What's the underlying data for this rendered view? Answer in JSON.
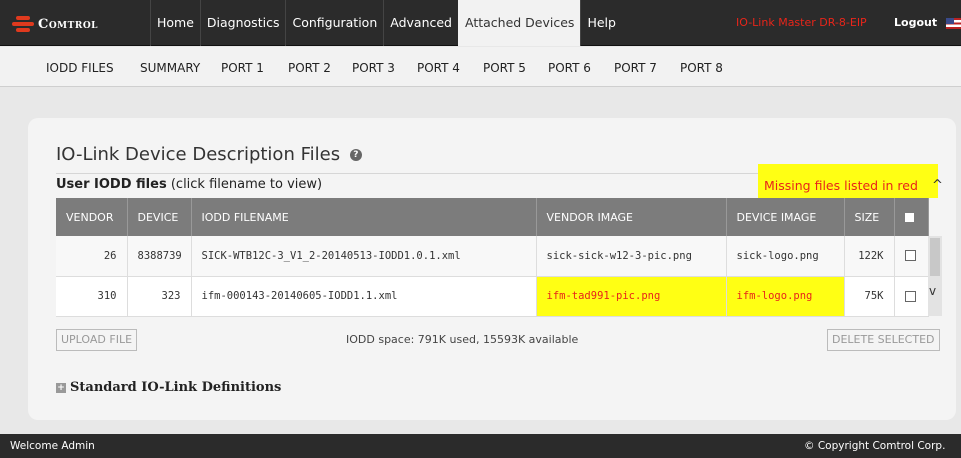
{
  "brand": {
    "logo_text": "Comtrol"
  },
  "nav": {
    "items": [
      "Home",
      "Diagnostics",
      "Configuration",
      "Advanced",
      "Attached Devices",
      "Help"
    ],
    "active": "Attached Devices",
    "device_name": "IO-Link Master DR-8-EIP",
    "logout": "Logout"
  },
  "subnav": {
    "items": [
      "IODD FILES",
      "SUMMARY",
      "PORT 1",
      "PORT 2",
      "PORT 3",
      "PORT 4",
      "PORT 5",
      "PORT 6",
      "PORT 7",
      "PORT 8"
    ]
  },
  "page": {
    "title": "IO-Link Device Description Files",
    "user_iodd_label": "User IODD files",
    "user_iodd_hint": "(click filename to view)",
    "missing_note": "Missing files listed in red"
  },
  "table": {
    "columns": [
      "VENDOR",
      "DEVICE",
      "IODD FILENAME",
      "VENDOR IMAGE",
      "DEVICE IMAGE",
      "SIZE"
    ],
    "rows": [
      {
        "vendor": "26",
        "device": "8388739",
        "filename": "SICK-WTB12C-3_V1_2-20140513-IODD1.0.1.xml",
        "vendor_image": "sick-sick-w12-3-pic.png",
        "device_image": "sick-logo.png",
        "size": "122K",
        "vendor_image_missing": false,
        "device_image_missing": false
      },
      {
        "vendor": "310",
        "device": "323",
        "filename": "ifm-000143-20140605-IODD1.1.xml",
        "vendor_image": "ifm-tad991-pic.png",
        "device_image": "ifm-logo.png",
        "size": "75K",
        "vendor_image_missing": true,
        "device_image_missing": true
      }
    ]
  },
  "actions": {
    "upload": "UPLOAD FILE",
    "delete": "DELETE SELECTED",
    "space_info": "IODD space: 791K used, 15593K available"
  },
  "standard_defs": "Standard IO-Link Definitions",
  "footer": {
    "welcome": "Welcome Admin",
    "copyright": "© Copyright Comtrol Corp."
  },
  "colors": {
    "missing_text": "#e8251a",
    "missing_highlight": "#ffff14",
    "header_bg": "#2b2b2b",
    "table_header": "#7c7c7c"
  }
}
